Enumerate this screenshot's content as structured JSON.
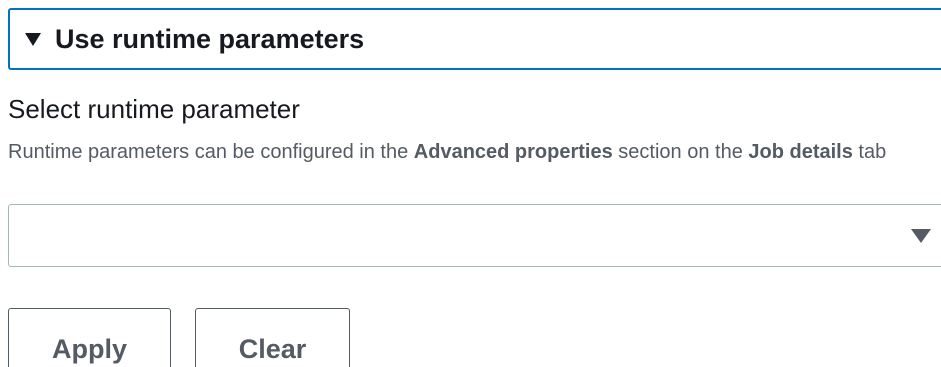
{
  "expander": {
    "label": "Use runtime parameters",
    "icon": "caret-down-icon"
  },
  "field": {
    "label": "Select runtime parameter",
    "description_prefix": "Runtime parameters can be configured in the ",
    "description_bold1": "Advanced properties",
    "description_middle": " section on the ",
    "description_bold2": "Job details",
    "description_suffix": " tab",
    "select_value": "",
    "select_icon": "caret-down-icon"
  },
  "buttons": {
    "apply_label": "Apply",
    "clear_label": "Clear"
  },
  "colors": {
    "accent": "#0073bb",
    "text": "#16191f",
    "secondary_text": "#545b64",
    "border": "#aab7b8"
  }
}
